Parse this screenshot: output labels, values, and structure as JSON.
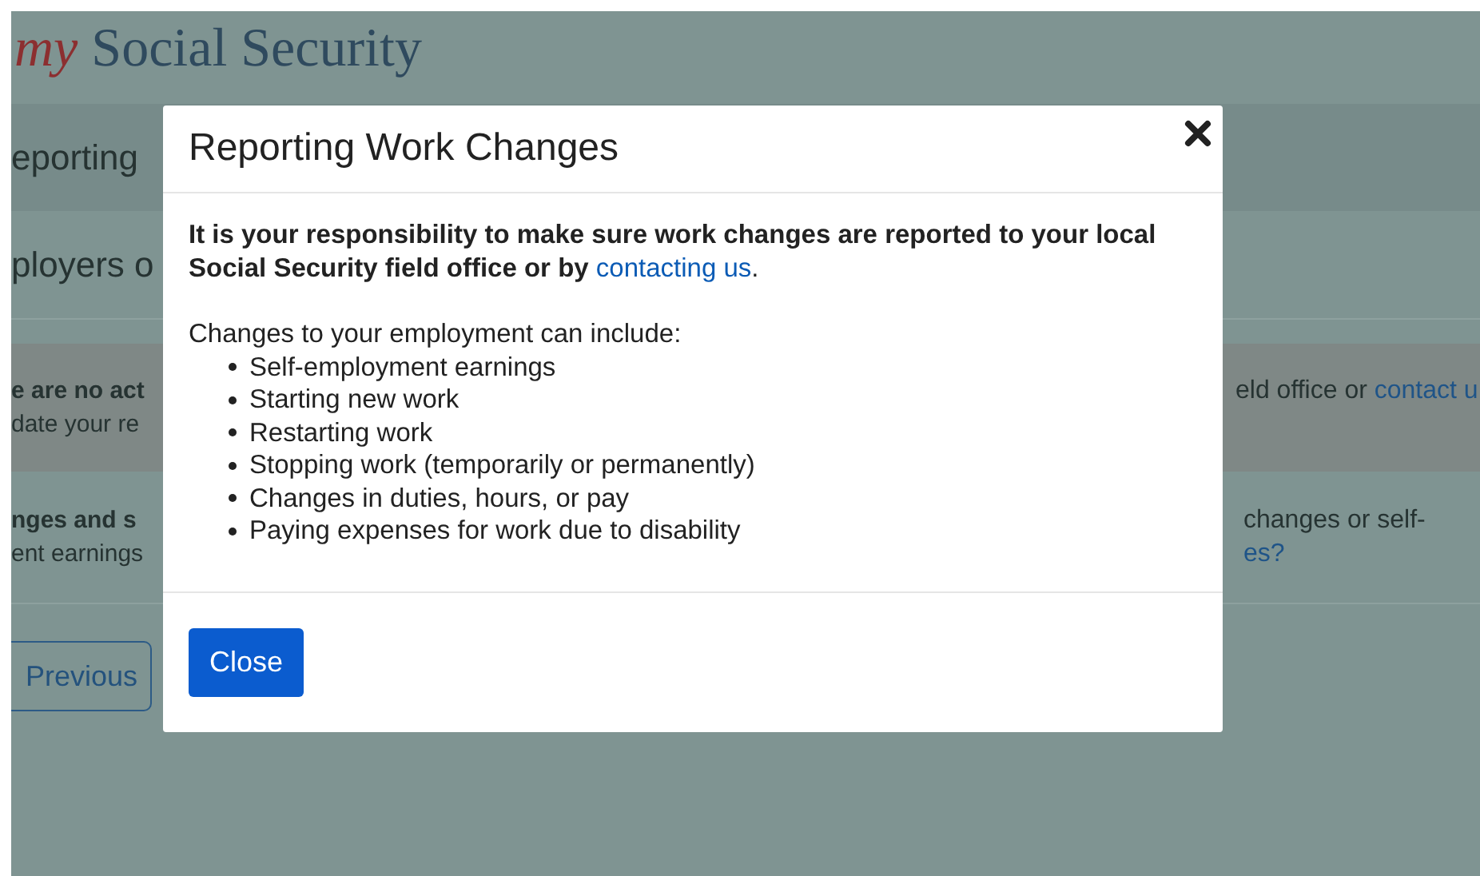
{
  "background_page": {
    "logo": {
      "prefix": "my",
      "name": "Social Security"
    },
    "heading": "eporting",
    "subheading": "ployers o",
    "alert": {
      "left_lines": [
        "e are no act",
        "date your re"
      ],
      "right_text": "eld office or",
      "right_link": "contact u"
    },
    "info": {
      "left_lines": [
        "nges and s",
        "ent earnings"
      ],
      "right_text": "changes or self-",
      "right_link": "es?"
    },
    "previous_button": "Previous"
  },
  "dialog": {
    "title": "Reporting Work Changes",
    "notice": "It is your responsibility to make sure work changes are reported to your local Social Security field office or by ",
    "notice_link": "contacting us",
    "notice_end": ".",
    "list_intro": "Changes to your employment can include:",
    "items": [
      "Self-employment earnings",
      "Starting new work",
      "Restarting work",
      "Stopping work (temporarily or permanently)",
      "Changes in duties, hours, or pay",
      "Paying expenses for work due to disability"
    ],
    "close_button": "Close"
  }
}
